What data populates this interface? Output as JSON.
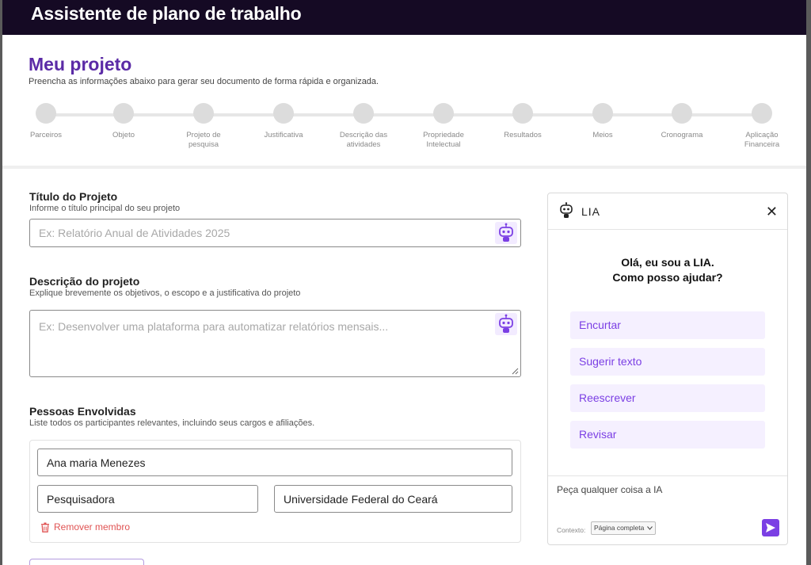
{
  "app": {
    "title": "Assistente de plano de trabalho"
  },
  "project": {
    "title": "Meu projeto",
    "subtitle": "Preencha as informações abaixo para gerar seu documento de forma rápida e organizada."
  },
  "steps": [
    {
      "label": "Parceiros"
    },
    {
      "label": "Objeto"
    },
    {
      "label": "Projeto de pesquisa"
    },
    {
      "label": "Justificativa"
    },
    {
      "label": "Descrição das atividades"
    },
    {
      "label": "Propriedade Intelectual"
    },
    {
      "label": "Resultados"
    },
    {
      "label": "Meios"
    },
    {
      "label": "Cronograma"
    },
    {
      "label": "Aplicação Financeira"
    }
  ],
  "form": {
    "titulo": {
      "label": "Título do Projeto",
      "help": "Informe o título principal do seu projeto",
      "placeholder": "Ex: Relatório Anual de Atividades 2025"
    },
    "descricao": {
      "label": "Descrição do projeto",
      "help": "Explique brevemente os objetivos, o escopo e a justificativa do projeto",
      "placeholder": "Ex: Desenvolver uma plataforma para automatizar relatórios mensais..."
    },
    "pessoas": {
      "label": "Pessoas Envolvidas",
      "help": "Liste todos os participantes relevantes, incluindo seus cargos e afiliações.",
      "member": {
        "name": "Ana maria Menezes",
        "role": "Pesquisadora",
        "affiliation": "Universidade Federal do Ceará",
        "remove_label": "Remover membro"
      }
    }
  },
  "lia": {
    "name": "LIA",
    "greeting_line1": "Olá, eu sou a LIA.",
    "greeting_line2": "Como posso ajudar?",
    "actions": [
      "Encurtar",
      "Sugerir texto",
      "Reescrever",
      "Revisar"
    ],
    "ask_placeholder": "Peça qualquer coisa a IA",
    "context_label": "Contexto:",
    "context_value": "Página completa"
  },
  "colors": {
    "header": "#150a24",
    "accent": "#7b3fe4",
    "title": "#5b2ba6",
    "danger": "#e05353"
  },
  "icons": [
    "robot-icon",
    "close-icon",
    "trash-icon",
    "send-icon",
    "chevron-down-icon"
  ]
}
